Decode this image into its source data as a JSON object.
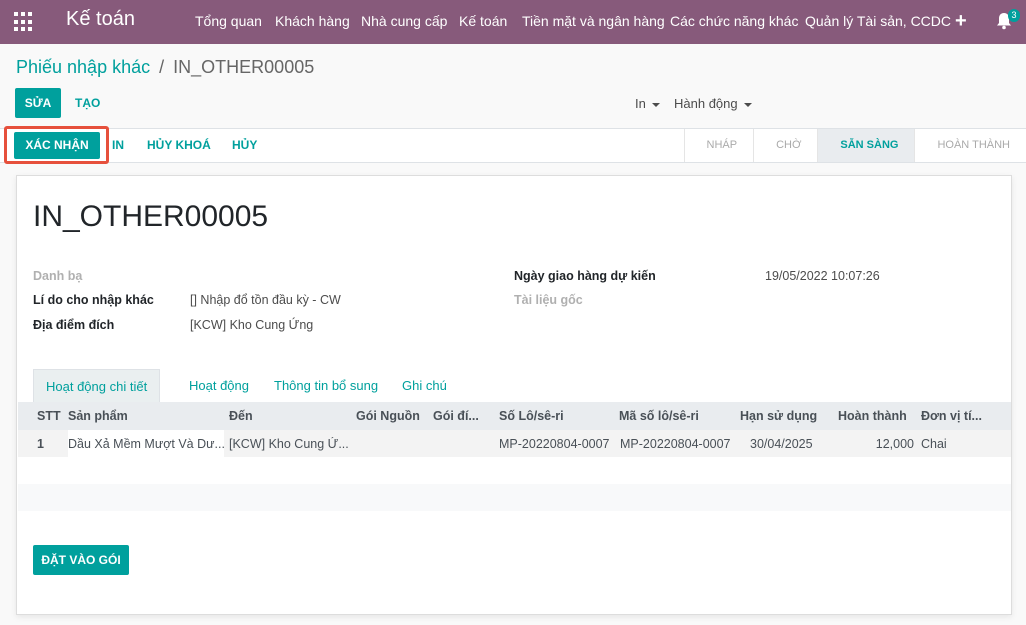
{
  "navbar": {
    "brand": "Kế toán",
    "menu": [
      "Tổng quan",
      "Khách hàng",
      "Nhà cung cấp",
      "Kế toán",
      "Tiền mặt và ngân hàng",
      "Các chức năng khác",
      "Quản lý Tài sản, CCDC"
    ],
    "notification_count": "3",
    "accent_color": "#875a7b"
  },
  "breadcrumb": {
    "parent": "Phiếu nhập khác",
    "separator": "/",
    "current": "IN_OTHER00005"
  },
  "control": {
    "edit_label": "SỬA",
    "create_label": "TẠO",
    "print_label": "In",
    "action_label": "Hành động"
  },
  "header_buttons": {
    "confirm": "XÁC NHẬN",
    "print": "IN",
    "unlock": "HỦY KHOÁ",
    "cancel": "HỦY"
  },
  "statusbar": {
    "stages": [
      "NHÁP",
      "CHỜ",
      "SẴN SÀNG",
      "HOÀN THÀNH"
    ],
    "active": "SẴN SÀNG"
  },
  "record": {
    "name": "IN_OTHER00005",
    "fields_left": [
      {
        "label": "Danh bạ",
        "value": ""
      },
      {
        "label": "Lí do cho nhập khác",
        "value": "[] Nhập đổ tồn đầu kỳ - CW"
      },
      {
        "label": "Địa điểm đích",
        "value": "[KCW] Kho Cung Ứng"
      }
    ],
    "fields_right": [
      {
        "label": "Ngày giao hàng dự kiến",
        "value": "19/05/2022 10:07:26"
      },
      {
        "label": "Tài liệu gốc",
        "value": ""
      }
    ]
  },
  "tabs": [
    "Hoạt động chi tiết",
    "Hoạt động",
    "Thông tin bổ sung",
    "Ghi chú"
  ],
  "table": {
    "columns": [
      "STT",
      "Sản phẩm",
      "Đến",
      "Gói Nguồn",
      "Gói đí...",
      "Số Lô/sê-ri",
      "Mã số lô/sê-ri",
      "Hạn sử dụng",
      "Hoàn thành",
      "Đơn vị tí..."
    ],
    "rows": [
      [
        "1",
        "Dầu Xả Mềm Mượt Và Dư...",
        "[KCW] Kho Cung Ứ...",
        "",
        "",
        "MP-20220804-0007",
        "MP-20220804-0007",
        "30/04/2025",
        "12,000",
        "Chai"
      ]
    ]
  },
  "put_in_pack_label": "ĐẶT VÀO GÓI",
  "colors": {
    "primary": "#00a09d",
    "highlight_border": "#e6503c"
  }
}
